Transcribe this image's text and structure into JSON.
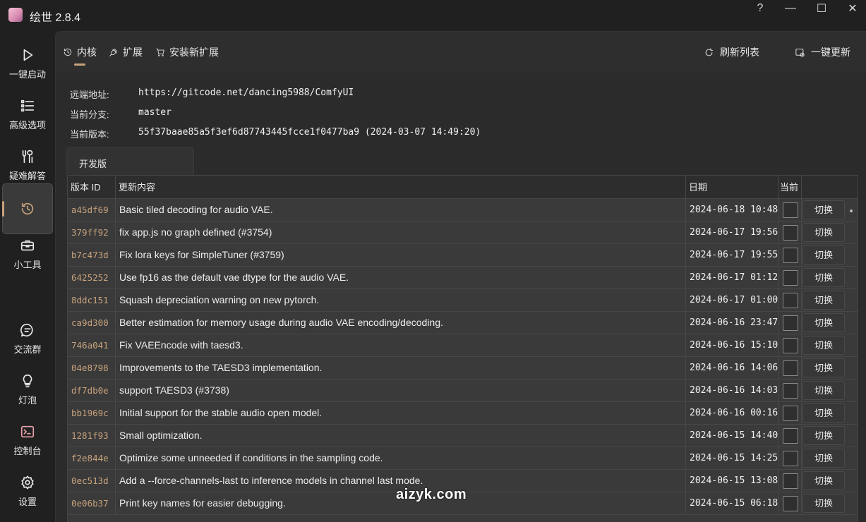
{
  "window": {
    "title": "绘世 2.8.4",
    "controls": {
      "help": "?",
      "minimize": "—",
      "maximize": "☐",
      "close": "✕"
    }
  },
  "nav": {
    "items": [
      {
        "label": "一键启动",
        "icon": "play-icon"
      },
      {
        "label": "高级选项",
        "icon": "list-icon"
      },
      {
        "label": "疑难解答",
        "icon": "tools-icon"
      },
      {
        "label": "",
        "icon": "history-icon",
        "active": true
      },
      {
        "label": "小工具",
        "icon": "toolbox-icon"
      },
      {
        "label": "交流群",
        "icon": "chat-icon"
      },
      {
        "label": "灯泡",
        "icon": "lightbulb-icon"
      },
      {
        "label": "控制台",
        "icon": "console-icon"
      },
      {
        "label": "设置",
        "icon": "gear-icon"
      }
    ]
  },
  "tabs": {
    "core": "内核",
    "extensions": "扩展",
    "install": "安装新扩展",
    "refresh": "刷新列表",
    "update_all": "一键更新"
  },
  "info": {
    "remote_label": "远端地址:",
    "remote_value": "https://gitcode.net/dancing5988/ComfyUI",
    "branch_label": "当前分支:",
    "branch_value": "master",
    "version_label": "当前版本:",
    "version_value": "55f37baae85a5f3ef6d87743445fcce1f0477ba9 (2024-03-07 14:49:20)"
  },
  "branch_tab": "开发版",
  "table": {
    "headers": [
      "版本 ID",
      "更新内容",
      "日期",
      "当前",
      ""
    ],
    "button_label": "切换",
    "rows": [
      {
        "id": "a45df69",
        "msg": "Basic tiled decoding for audio VAE.",
        "date": "2024-06-18 10:48"
      },
      {
        "id": "379ff92",
        "msg": "fix app.js no graph defined (#3754)",
        "date": "2024-06-17 19:56"
      },
      {
        "id": "b7c473d",
        "msg": "Fix lora keys for SimpleTuner (#3759)",
        "date": "2024-06-17 19:55"
      },
      {
        "id": "6425252",
        "msg": "Use fp16 as the default vae dtype for the audio VAE.",
        "date": "2024-06-17 01:12"
      },
      {
        "id": "8ddc151",
        "msg": "Squash depreciation warning on new pytorch.",
        "date": "2024-06-17 01:00"
      },
      {
        "id": "ca9d300",
        "msg": "Better estimation for memory usage during audio VAE encoding/decoding.",
        "date": "2024-06-16 23:47"
      },
      {
        "id": "746a041",
        "msg": "Fix VAEEncode with taesd3.",
        "date": "2024-06-16 15:10"
      },
      {
        "id": "04e8798",
        "msg": "Improvements to the TAESD3 implementation.",
        "date": "2024-06-16 14:06"
      },
      {
        "id": "df7db0e",
        "msg": "support TAESD3 (#3738)",
        "date": "2024-06-16 14:03"
      },
      {
        "id": "bb1969c",
        "msg": "Initial support for the stable audio open model.",
        "date": "2024-06-16 00:16"
      },
      {
        "id": "1281f93",
        "msg": "Small optimization.",
        "date": "2024-06-15 14:40"
      },
      {
        "id": "f2e844e",
        "msg": "Optimize some unneeded if conditions in the sampling code.",
        "date": "2024-06-15 14:25"
      },
      {
        "id": "0ec513d",
        "msg": "Add a --force-channels-last to inference models in channel last mode.",
        "date": "2024-06-15 13:08"
      },
      {
        "id": "0e06b37",
        "msg": "Print key names for easier debugging.",
        "date": "2024-06-15 06:18"
      }
    ]
  },
  "watermark": "aizyk.com",
  "colors": {
    "accent": "#c7a27c",
    "background": "#202020",
    "panel": "#2b2b2b",
    "row": "#3a3a3a"
  }
}
